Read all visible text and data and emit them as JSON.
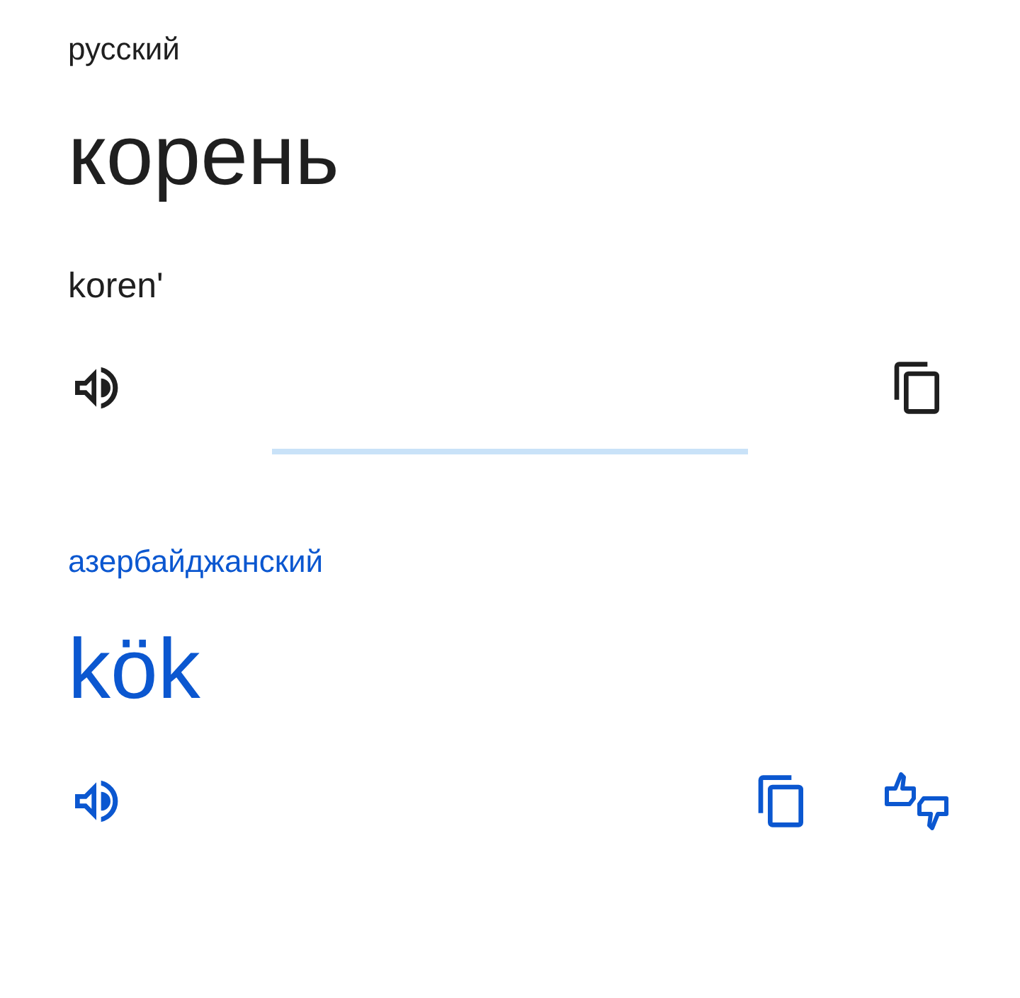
{
  "source": {
    "language": "русский",
    "text": "корень",
    "transliteration": "koren'"
  },
  "target": {
    "language": "азербайджанский",
    "text": "kök"
  }
}
